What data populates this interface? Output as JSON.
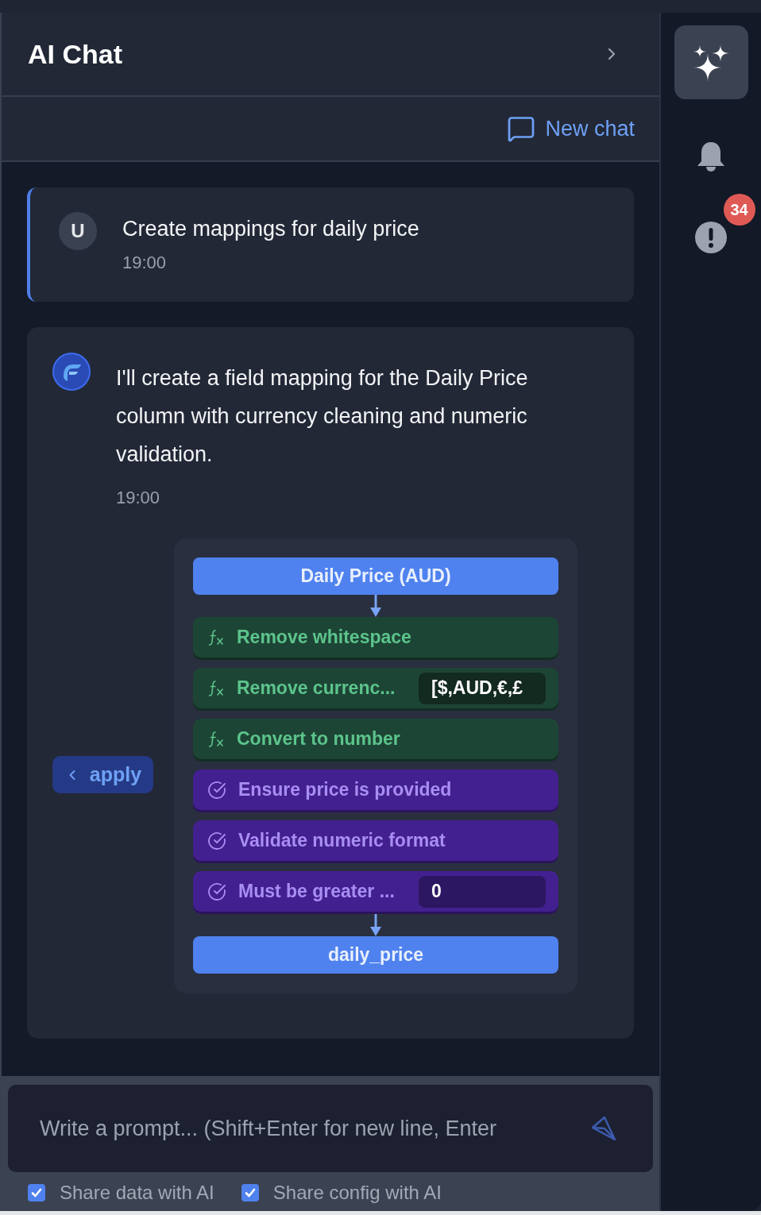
{
  "header": {
    "title": "AI Chat"
  },
  "toolbar": {
    "new_chat": "New chat"
  },
  "messages": [
    {
      "kind": "user",
      "avatar": "U",
      "text": "Create mappings for daily price",
      "time": "19:00"
    },
    {
      "kind": "assistant",
      "text": "I'll create a field mapping for the Daily Price column with currency cleaning and numeric validation.",
      "time": "19:00",
      "action": "apply",
      "pipeline": {
        "source": "Daily Price (AUD)",
        "steps": [
          {
            "kind": "transform",
            "label": "Remove whitespace"
          },
          {
            "kind": "transform",
            "label": "Remove currenc...",
            "value": "[$,AUD,€,£"
          },
          {
            "kind": "transform",
            "label": "Convert to number"
          },
          {
            "kind": "validation",
            "label": "Ensure price is provided"
          },
          {
            "kind": "validation",
            "label": "Validate numeric format"
          },
          {
            "kind": "validation",
            "label": "Must be greater ...",
            "value": "0"
          }
        ],
        "target": "daily_price"
      }
    }
  ],
  "composer": {
    "placeholder": "Write a prompt... (Shift+Enter for new line, Enter",
    "send_disabled": true,
    "options": [
      {
        "label": "Share data with AI",
        "checked": true
      },
      {
        "label": "Share config with AI",
        "checked": true
      }
    ]
  },
  "rail": {
    "items": [
      {
        "kind": "assistant",
        "selected": true
      },
      {
        "kind": "notifications",
        "selected": false
      },
      {
        "kind": "alerts",
        "selected": false,
        "badge": "34"
      }
    ]
  }
}
